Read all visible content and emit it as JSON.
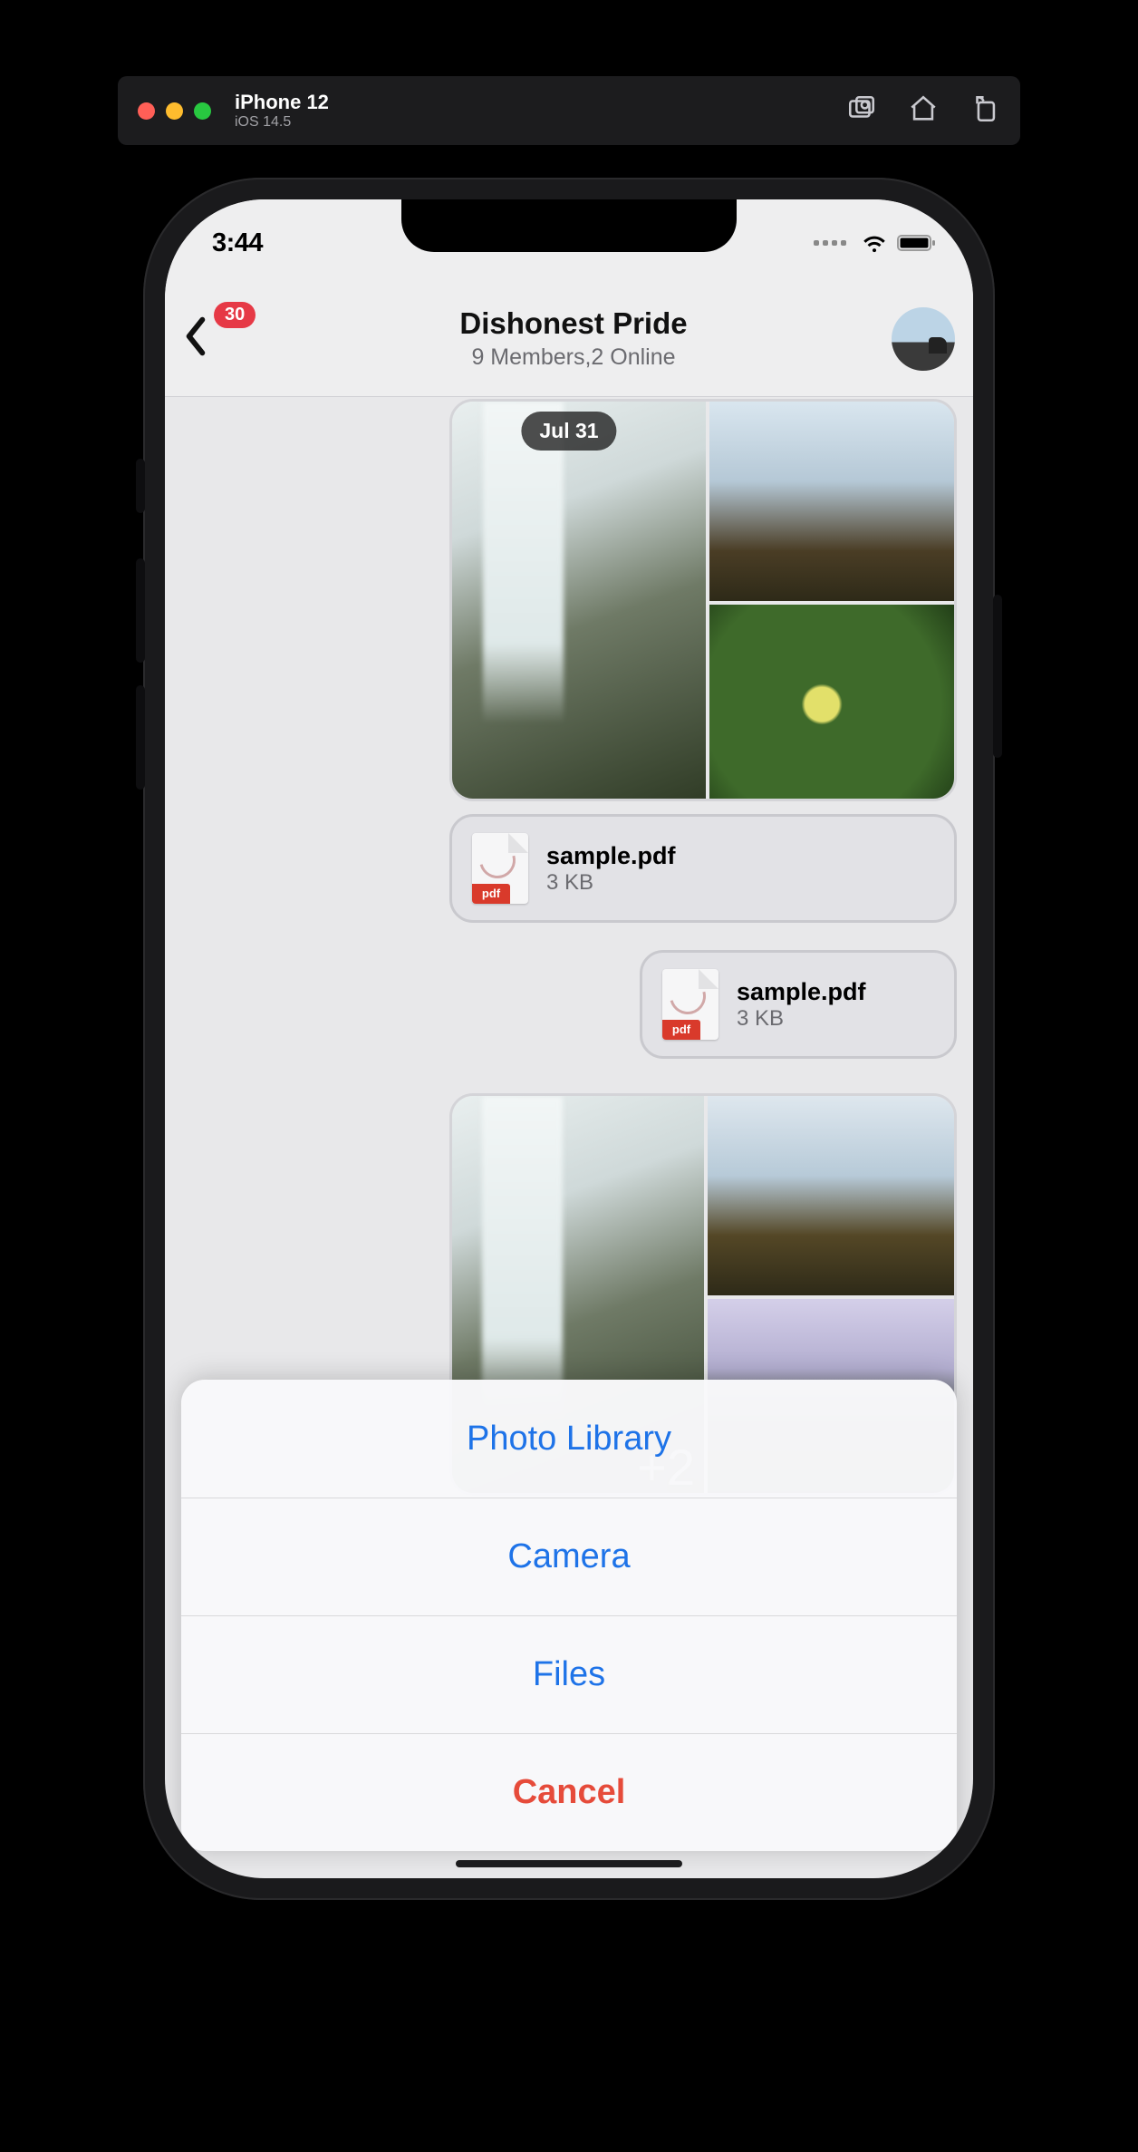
{
  "simulator": {
    "device": "iPhone 12",
    "ios": "iOS 14.5"
  },
  "status": {
    "time": "3:44"
  },
  "header": {
    "unread_badge": "30",
    "title": "Dishonest Pride",
    "subtitle": "9 Members,2 Online"
  },
  "chat": {
    "date_chip": "Jul 31",
    "file1": {
      "name": "sample.pdf",
      "size": "3 KB",
      "ext": "pdf"
    },
    "file2": {
      "name": "sample.pdf",
      "size": "3 KB",
      "ext": "pdf"
    },
    "collage_overflow": "+2"
  },
  "action_sheet": {
    "photo_library": "Photo Library",
    "camera": "Camera",
    "files": "Files",
    "cancel": "Cancel"
  }
}
